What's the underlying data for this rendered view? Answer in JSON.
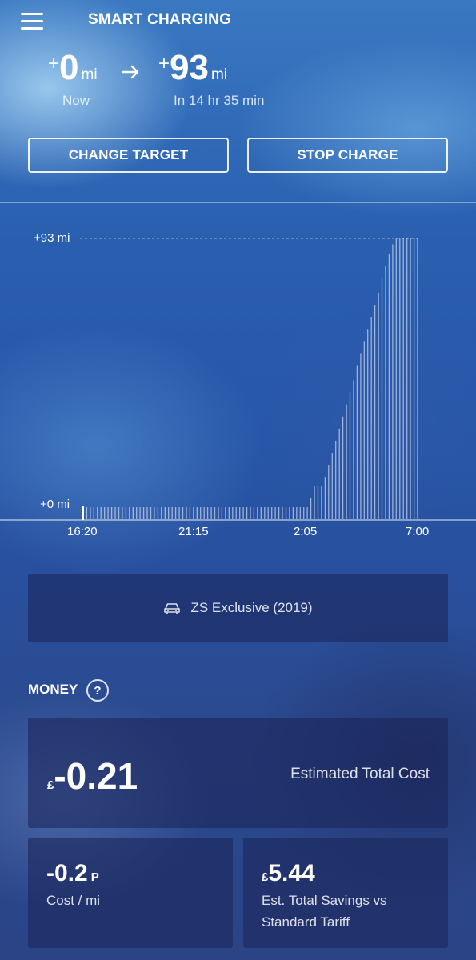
{
  "header": {
    "title": "SMART CHARGING"
  },
  "range": {
    "current": {
      "prefix": "+",
      "value": "0",
      "unit": "mi",
      "caption": "Now"
    },
    "target": {
      "prefix": "+",
      "value": "93",
      "unit": "mi",
      "caption": "In 14 hr 35 min"
    }
  },
  "buttons": {
    "change_target": "CHANGE TARGET",
    "stop_charge": "STOP CHARGE"
  },
  "chart_data": {
    "type": "bar",
    "y_top_label": "+93 mi",
    "y_bottom_label": "+0 mi",
    "ylim": [
      0,
      93
    ],
    "x_tick_labels": [
      "16:20",
      "21:15",
      "2:05",
      "7:00"
    ],
    "values": [
      0,
      0,
      0,
      0,
      0,
      0,
      0,
      0,
      0,
      0,
      0,
      0,
      0,
      0,
      0,
      0,
      0,
      0,
      0,
      0,
      0,
      0,
      0,
      0,
      0,
      0,
      0,
      0,
      0,
      0,
      0,
      0,
      0,
      0,
      0,
      0,
      0,
      0,
      0,
      0,
      0,
      0,
      0,
      0,
      0,
      0,
      0,
      0,
      0,
      0,
      0,
      0,
      0,
      0,
      0,
      0,
      0,
      0,
      0,
      0,
      0,
      0,
      0.5,
      3,
      7,
      11,
      11,
      11,
      14,
      18,
      22,
      26,
      30,
      34,
      38,
      42,
      46,
      51,
      55,
      59,
      63,
      67,
      71,
      75,
      80,
      84,
      88,
      91,
      93,
      93,
      93,
      93,
      93,
      93,
      93
    ]
  },
  "vehicle": {
    "name": "ZS Exclusive (2019)"
  },
  "money": {
    "title": "MONEY",
    "help": "?",
    "total": {
      "currency": "£",
      "value": "-0.21",
      "label": "Estimated Total Cost"
    },
    "per_mile": {
      "value": "-0.2",
      "unit": "P",
      "label": "Cost / mi"
    },
    "savings": {
      "currency": "£",
      "value": "5.44",
      "label_line1": "Est. Total Savings vs",
      "label_line2": "Standard Tariff"
    }
  }
}
